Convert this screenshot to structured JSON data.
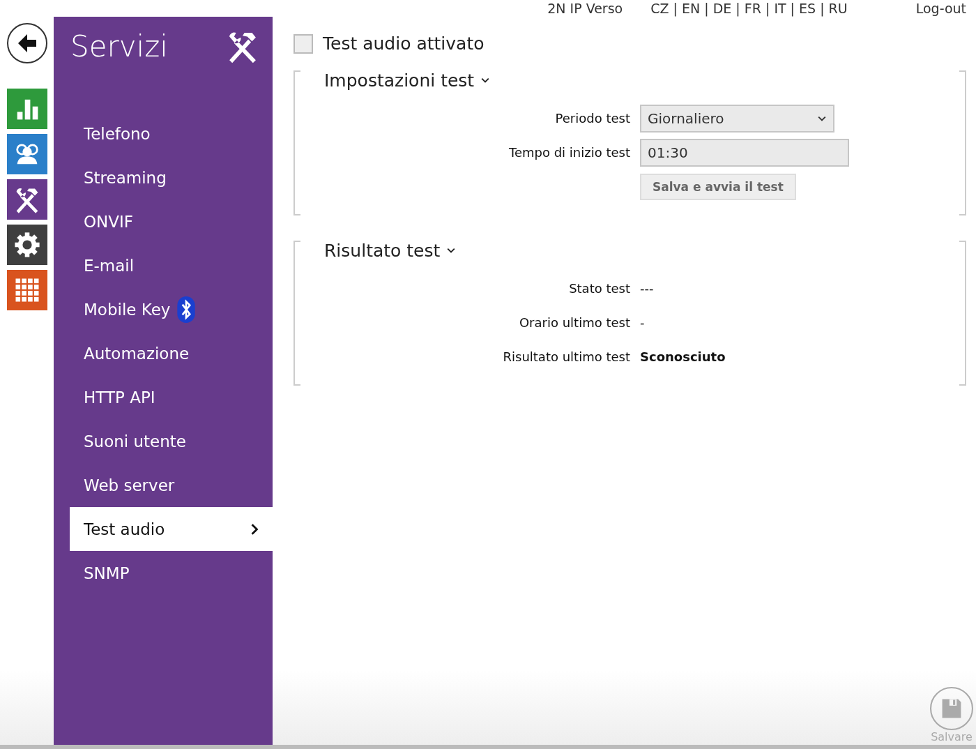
{
  "top_bar": {
    "device": "2N IP Verso",
    "languages": "CZ | EN | DE | FR | IT | ES | RU",
    "logout": "Log-out"
  },
  "rail": [
    {
      "kind": "back"
    },
    {
      "kind": "stats",
      "color": "#2e9a3c"
    },
    {
      "kind": "users",
      "color": "#2a7fc9"
    },
    {
      "kind": "services",
      "color": "#673a8c"
    },
    {
      "kind": "settings",
      "color": "#3f3f3f"
    },
    {
      "kind": "apps",
      "color": "#d9531e"
    }
  ],
  "sidebar": {
    "title": "Servizi",
    "items": [
      {
        "label": "Telefono",
        "selected": false,
        "bluetooth": false
      },
      {
        "label": "Streaming",
        "selected": false,
        "bluetooth": false
      },
      {
        "label": "ONVIF",
        "selected": false,
        "bluetooth": false
      },
      {
        "label": "E-mail",
        "selected": false,
        "bluetooth": false
      },
      {
        "label": "Mobile Key",
        "selected": false,
        "bluetooth": true
      },
      {
        "label": "Automazione",
        "selected": false,
        "bluetooth": false
      },
      {
        "label": "HTTP API",
        "selected": false,
        "bluetooth": false
      },
      {
        "label": "Suoni utente",
        "selected": false,
        "bluetooth": false
      },
      {
        "label": "Web server",
        "selected": false,
        "bluetooth": false
      },
      {
        "label": "Test audio",
        "selected": true,
        "bluetooth": false
      },
      {
        "label": "SNMP",
        "selected": false,
        "bluetooth": false
      }
    ]
  },
  "enable": {
    "label": "Test audio attivato",
    "checked": false
  },
  "sections": [
    {
      "title": "Impostazioni test",
      "expanded": true,
      "rows": [
        {
          "kind": "select",
          "label": "Periodo test",
          "value": "Giornaliero"
        },
        {
          "kind": "input",
          "label": "Tempo di inizio test",
          "value": "01:30"
        },
        {
          "kind": "button",
          "value": "Salva e avvia il test"
        }
      ]
    },
    {
      "title": "Risultato test",
      "expanded": true,
      "rows": [
        {
          "kind": "text",
          "label": "Stato test",
          "value": "---"
        },
        {
          "kind": "text",
          "label": "Orario ultimo test",
          "value": "-"
        },
        {
          "kind": "strong",
          "label": "Risultato ultimo test",
          "value": "Sconosciuto"
        }
      ]
    }
  ],
  "save": {
    "label": "Salvare",
    "disabled": true
  }
}
